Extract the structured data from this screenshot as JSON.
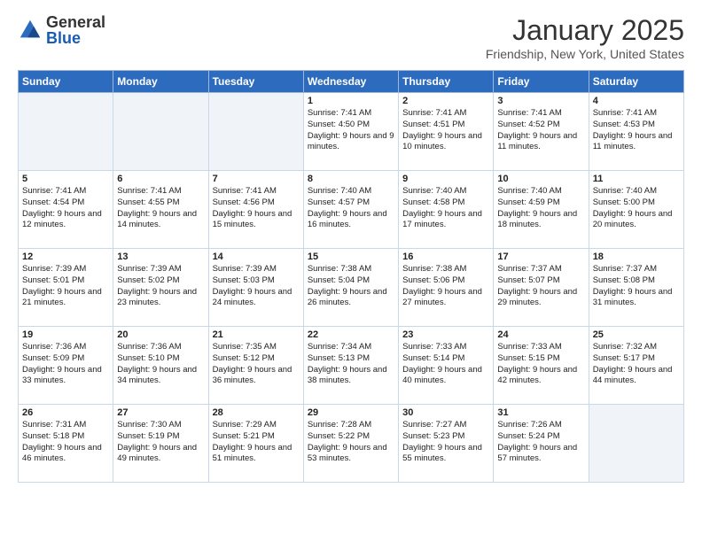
{
  "header": {
    "logo_general": "General",
    "logo_blue": "Blue",
    "month_title": "January 2025",
    "location": "Friendship, New York, United States"
  },
  "weekdays": [
    "Sunday",
    "Monday",
    "Tuesday",
    "Wednesday",
    "Thursday",
    "Friday",
    "Saturday"
  ],
  "weeks": [
    [
      {
        "day": "",
        "empty": true
      },
      {
        "day": "",
        "empty": true
      },
      {
        "day": "",
        "empty": true
      },
      {
        "day": "1",
        "sunrise": "Sunrise: 7:41 AM",
        "sunset": "Sunset: 4:50 PM",
        "daylight": "Daylight: 9 hours and 9 minutes."
      },
      {
        "day": "2",
        "sunrise": "Sunrise: 7:41 AM",
        "sunset": "Sunset: 4:51 PM",
        "daylight": "Daylight: 9 hours and 10 minutes."
      },
      {
        "day": "3",
        "sunrise": "Sunrise: 7:41 AM",
        "sunset": "Sunset: 4:52 PM",
        "daylight": "Daylight: 9 hours and 11 minutes."
      },
      {
        "day": "4",
        "sunrise": "Sunrise: 7:41 AM",
        "sunset": "Sunset: 4:53 PM",
        "daylight": "Daylight: 9 hours and 11 minutes."
      }
    ],
    [
      {
        "day": "5",
        "sunrise": "Sunrise: 7:41 AM",
        "sunset": "Sunset: 4:54 PM",
        "daylight": "Daylight: 9 hours and 12 minutes."
      },
      {
        "day": "6",
        "sunrise": "Sunrise: 7:41 AM",
        "sunset": "Sunset: 4:55 PM",
        "daylight": "Daylight: 9 hours and 14 minutes."
      },
      {
        "day": "7",
        "sunrise": "Sunrise: 7:41 AM",
        "sunset": "Sunset: 4:56 PM",
        "daylight": "Daylight: 9 hours and 15 minutes."
      },
      {
        "day": "8",
        "sunrise": "Sunrise: 7:40 AM",
        "sunset": "Sunset: 4:57 PM",
        "daylight": "Daylight: 9 hours and 16 minutes."
      },
      {
        "day": "9",
        "sunrise": "Sunrise: 7:40 AM",
        "sunset": "Sunset: 4:58 PM",
        "daylight": "Daylight: 9 hours and 17 minutes."
      },
      {
        "day": "10",
        "sunrise": "Sunrise: 7:40 AM",
        "sunset": "Sunset: 4:59 PM",
        "daylight": "Daylight: 9 hours and 18 minutes."
      },
      {
        "day": "11",
        "sunrise": "Sunrise: 7:40 AM",
        "sunset": "Sunset: 5:00 PM",
        "daylight": "Daylight: 9 hours and 20 minutes."
      }
    ],
    [
      {
        "day": "12",
        "sunrise": "Sunrise: 7:39 AM",
        "sunset": "Sunset: 5:01 PM",
        "daylight": "Daylight: 9 hours and 21 minutes."
      },
      {
        "day": "13",
        "sunrise": "Sunrise: 7:39 AM",
        "sunset": "Sunset: 5:02 PM",
        "daylight": "Daylight: 9 hours and 23 minutes."
      },
      {
        "day": "14",
        "sunrise": "Sunrise: 7:39 AM",
        "sunset": "Sunset: 5:03 PM",
        "daylight": "Daylight: 9 hours and 24 minutes."
      },
      {
        "day": "15",
        "sunrise": "Sunrise: 7:38 AM",
        "sunset": "Sunset: 5:04 PM",
        "daylight": "Daylight: 9 hours and 26 minutes."
      },
      {
        "day": "16",
        "sunrise": "Sunrise: 7:38 AM",
        "sunset": "Sunset: 5:06 PM",
        "daylight": "Daylight: 9 hours and 27 minutes."
      },
      {
        "day": "17",
        "sunrise": "Sunrise: 7:37 AM",
        "sunset": "Sunset: 5:07 PM",
        "daylight": "Daylight: 9 hours and 29 minutes."
      },
      {
        "day": "18",
        "sunrise": "Sunrise: 7:37 AM",
        "sunset": "Sunset: 5:08 PM",
        "daylight": "Daylight: 9 hours and 31 minutes."
      }
    ],
    [
      {
        "day": "19",
        "sunrise": "Sunrise: 7:36 AM",
        "sunset": "Sunset: 5:09 PM",
        "daylight": "Daylight: 9 hours and 33 minutes."
      },
      {
        "day": "20",
        "sunrise": "Sunrise: 7:36 AM",
        "sunset": "Sunset: 5:10 PM",
        "daylight": "Daylight: 9 hours and 34 minutes."
      },
      {
        "day": "21",
        "sunrise": "Sunrise: 7:35 AM",
        "sunset": "Sunset: 5:12 PM",
        "daylight": "Daylight: 9 hours and 36 minutes."
      },
      {
        "day": "22",
        "sunrise": "Sunrise: 7:34 AM",
        "sunset": "Sunset: 5:13 PM",
        "daylight": "Daylight: 9 hours and 38 minutes."
      },
      {
        "day": "23",
        "sunrise": "Sunrise: 7:33 AM",
        "sunset": "Sunset: 5:14 PM",
        "daylight": "Daylight: 9 hours and 40 minutes."
      },
      {
        "day": "24",
        "sunrise": "Sunrise: 7:33 AM",
        "sunset": "Sunset: 5:15 PM",
        "daylight": "Daylight: 9 hours and 42 minutes."
      },
      {
        "day": "25",
        "sunrise": "Sunrise: 7:32 AM",
        "sunset": "Sunset: 5:17 PM",
        "daylight": "Daylight: 9 hours and 44 minutes."
      }
    ],
    [
      {
        "day": "26",
        "sunrise": "Sunrise: 7:31 AM",
        "sunset": "Sunset: 5:18 PM",
        "daylight": "Daylight: 9 hours and 46 minutes."
      },
      {
        "day": "27",
        "sunrise": "Sunrise: 7:30 AM",
        "sunset": "Sunset: 5:19 PM",
        "daylight": "Daylight: 9 hours and 49 minutes."
      },
      {
        "day": "28",
        "sunrise": "Sunrise: 7:29 AM",
        "sunset": "Sunset: 5:21 PM",
        "daylight": "Daylight: 9 hours and 51 minutes."
      },
      {
        "day": "29",
        "sunrise": "Sunrise: 7:28 AM",
        "sunset": "Sunset: 5:22 PM",
        "daylight": "Daylight: 9 hours and 53 minutes."
      },
      {
        "day": "30",
        "sunrise": "Sunrise: 7:27 AM",
        "sunset": "Sunset: 5:23 PM",
        "daylight": "Daylight: 9 hours and 55 minutes."
      },
      {
        "day": "31",
        "sunrise": "Sunrise: 7:26 AM",
        "sunset": "Sunset: 5:24 PM",
        "daylight": "Daylight: 9 hours and 57 minutes."
      },
      {
        "day": "",
        "empty": true
      }
    ]
  ]
}
